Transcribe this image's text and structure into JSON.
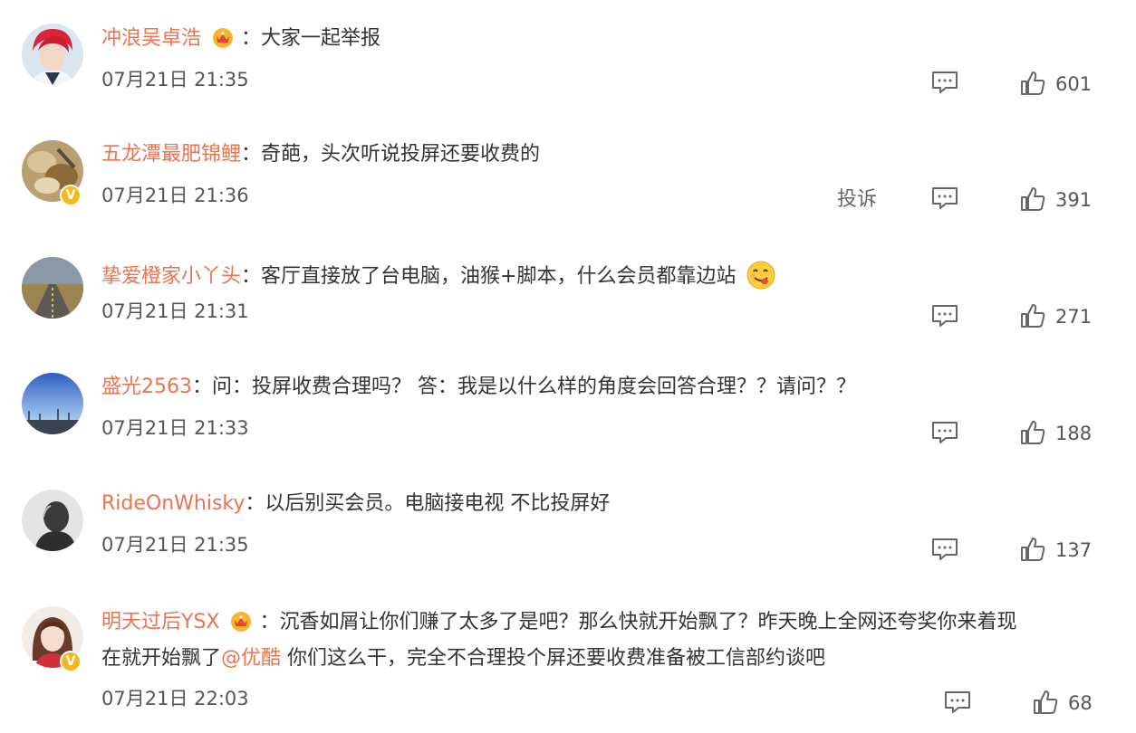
{
  "comments": [
    {
      "username": "冲浪吴卓浩",
      "separator": "：",
      "text": "大家一起举报",
      "time": "07月21日 21:35",
      "likes": "601",
      "avatar_icon": "avatar-red-hair-person",
      "badge_icon": "vip-crown-icon"
    },
    {
      "username": "五龙潭最肥锦鲤",
      "separator": "：",
      "text": "奇葩，头次听说投屏还要收费的",
      "time": "07月21日 21:36",
      "likes": "391",
      "report_label": "投诉",
      "avatar_icon": "avatar-food",
      "verified_icon": "verified-v-icon",
      "verified_label": "V"
    },
    {
      "username": "挚爱橙家小丫头",
      "separator": "：",
      "text": "客厅直接放了台电脑，油猴+脚本，什么会员都靠边站",
      "time": "07月21日 21:31",
      "likes": "271",
      "avatar_icon": "avatar-road",
      "emoji_icon": "yummy-face-emoji"
    },
    {
      "username": "盛光2563",
      "separator": "：",
      "text": "问：投屏收费合理吗？ 答：我是以什么样的角度会回答合理？？请问？？",
      "time": "07月21日 21:33",
      "likes": "188",
      "avatar_icon": "avatar-sky"
    },
    {
      "username": "RideOnWhisky",
      "separator": "：",
      "text": "以后别买会员。电脑接电视 不比投屏好",
      "time": "07月21日 21:35",
      "likes": "137",
      "avatar_icon": "avatar-silhouette"
    },
    {
      "username": "明天过后YSX",
      "separator": "：",
      "text": "沉香如屑让你们赚了太多了是吧？那么快就开始飘了？昨天晚上全网还夸奖你来着现",
      "text_line2_prefix": "在就开始飘了",
      "mention": "@优酷",
      "text_line2_suffix": " 你们这么干，完全不合理投个屏还要收费准备被工信部约谈吧",
      "time": "07月21日 22:03",
      "likes": "68",
      "avatar_icon": "avatar-woman",
      "badge_icon": "vip-crown-icon",
      "verified_icon": "verified-v-icon",
      "verified_label": "V"
    }
  ],
  "colors": {
    "username": "#eb7350",
    "text": "#333333",
    "meta": "#555555",
    "icon": "#666666",
    "verified": "#f5b81b"
  }
}
